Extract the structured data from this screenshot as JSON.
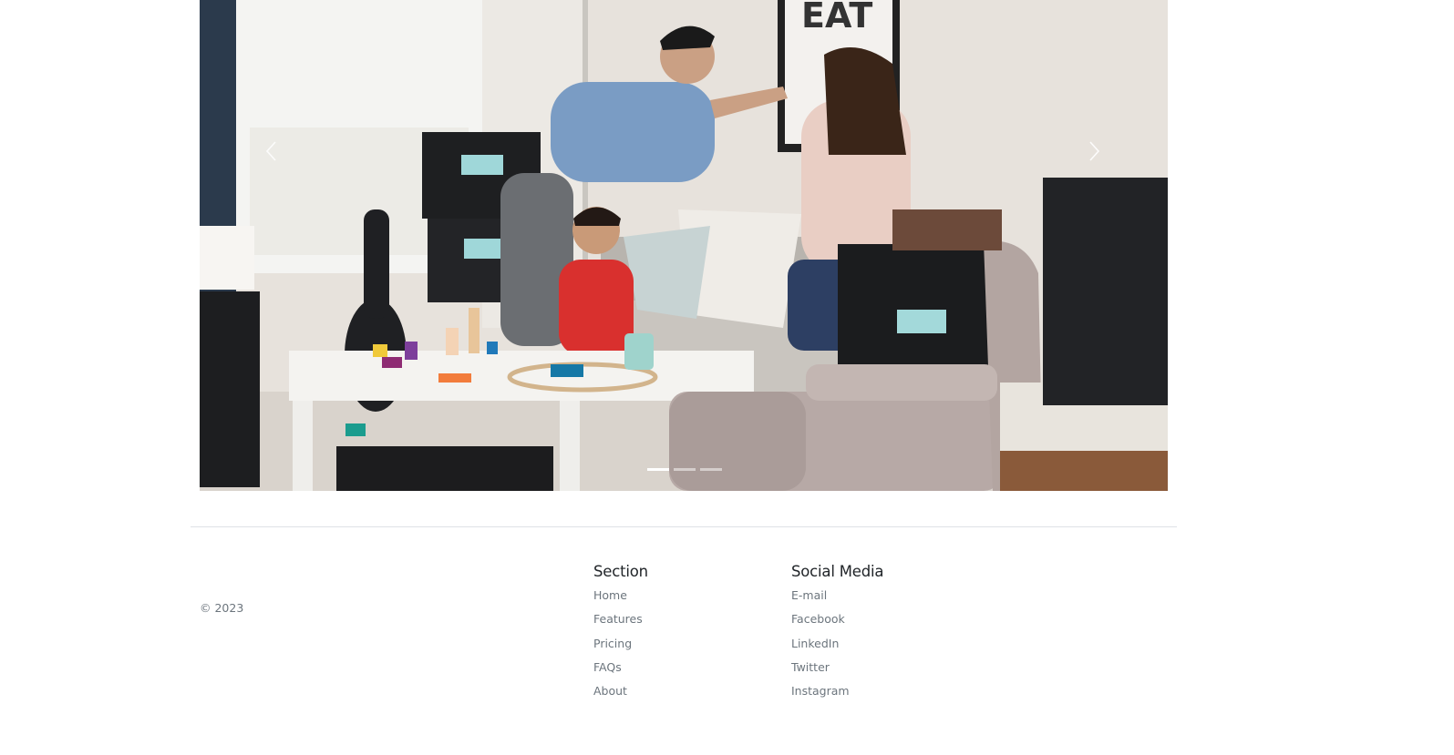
{
  "carousel": {
    "prev_icon": "chevron-left-icon",
    "next_icon": "chevron-right-icon",
    "slide_count": 3,
    "active_slide": 1
  },
  "footer": {
    "copyright": "© 2023",
    "section": {
      "heading": "Section",
      "links": [
        "Home",
        "Features",
        "Pricing",
        "FAQs",
        "About"
      ]
    },
    "social": {
      "heading": "Social Media",
      "links": [
        "E-mail",
        "Facebook",
        "LinkedIn",
        "Twitter",
        "Instagram"
      ]
    }
  }
}
